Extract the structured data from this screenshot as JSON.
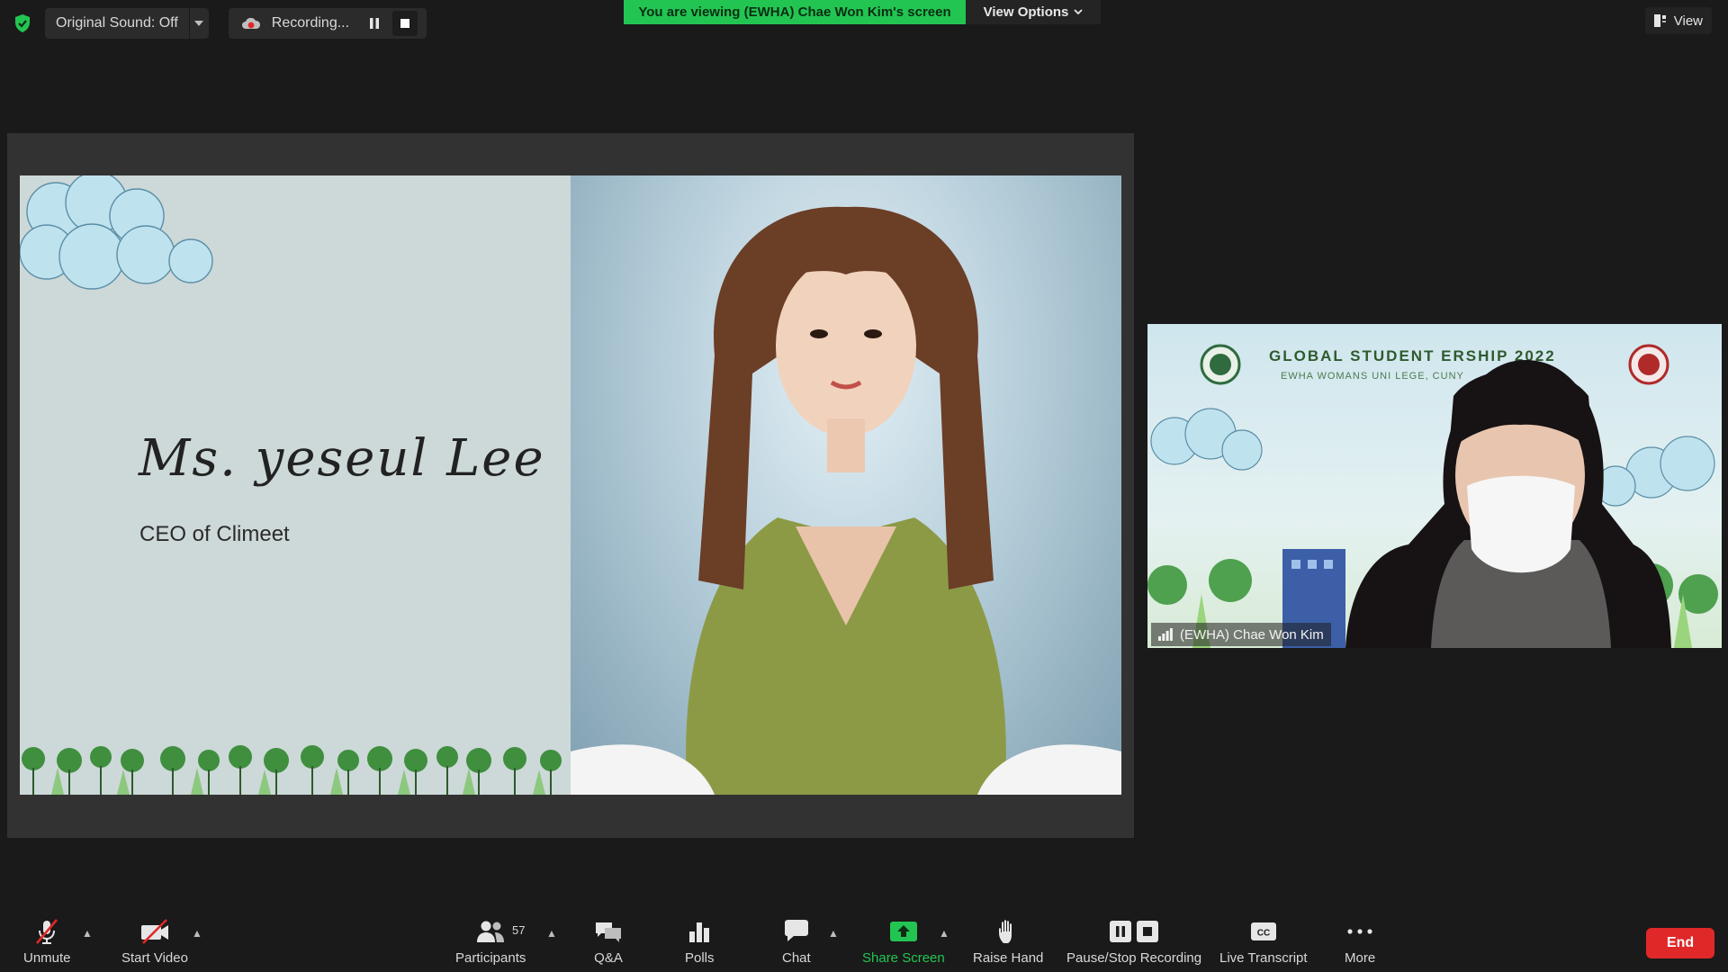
{
  "topbar": {
    "original_sound": "Original Sound: Off",
    "recording": "Recording...",
    "banner": "You are viewing (EWHA) Chae Won Kim's screen",
    "view_options": "View Options",
    "view": "View"
  },
  "slide": {
    "name": "Ms. yeseul Lee",
    "role": "CEO of Climeet"
  },
  "participant_tile": {
    "title": "GLOBAL STUDENT   ERSHIP 2022",
    "subtitle": "EWHA WOMANS UNI           LEGE, CUNY",
    "name": "(EWHA) Chae Won Kim"
  },
  "toolbar": {
    "unmute": "Unmute",
    "start_video": "Start Video",
    "participants": "Participants",
    "participant_count": "57",
    "qa": "Q&A",
    "polls": "Polls",
    "chat": "Chat",
    "share_screen": "Share Screen",
    "raise_hand": "Raise Hand",
    "pause_stop_recording": "Pause/Stop Recording",
    "live_transcript": "Live Transcript",
    "more": "More",
    "end": "End"
  },
  "colors": {
    "accent_green": "#23c552",
    "end_red": "#e02828",
    "background": "#1a1a1a"
  }
}
